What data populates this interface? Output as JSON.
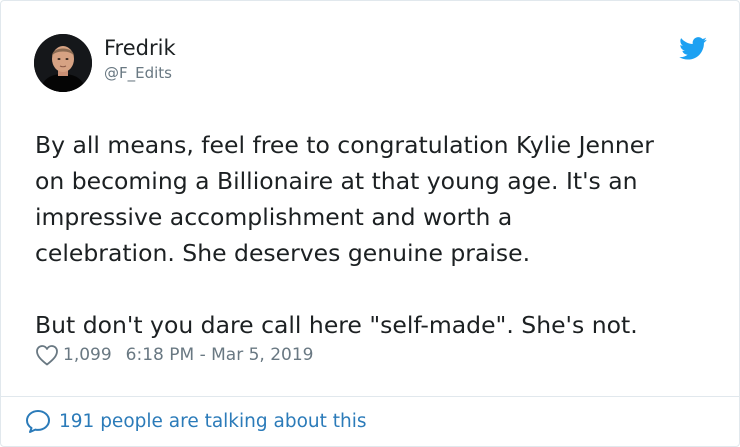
{
  "user": {
    "name": "Fredrik",
    "handle": "@F_Edits",
    "avatar_icon": "profile-photo"
  },
  "tweet": {
    "paragraph1": "By all means, feel free to congratulation Kylie Jenner\non becoming a Billionaire at that young age. It's an\nimpressive accomplishment and worth a\ncelebration. She deserves genuine praise.",
    "paragraph2": "But don't you dare call here \"self-made\". She's not.",
    "likes": "1,099",
    "timestamp": "6:18 PM - Mar 5, 2019"
  },
  "footer": {
    "talking_text": "191 people are talking about this"
  },
  "colors": {
    "twitter_blue": "#1da1f2",
    "link_blue": "#2b7bb9",
    "muted": "#697882",
    "text": "#1c2022"
  },
  "icons": {
    "brand": "twitter-bird-icon",
    "like": "heart-icon",
    "reply": "speech-bubble-icon"
  }
}
